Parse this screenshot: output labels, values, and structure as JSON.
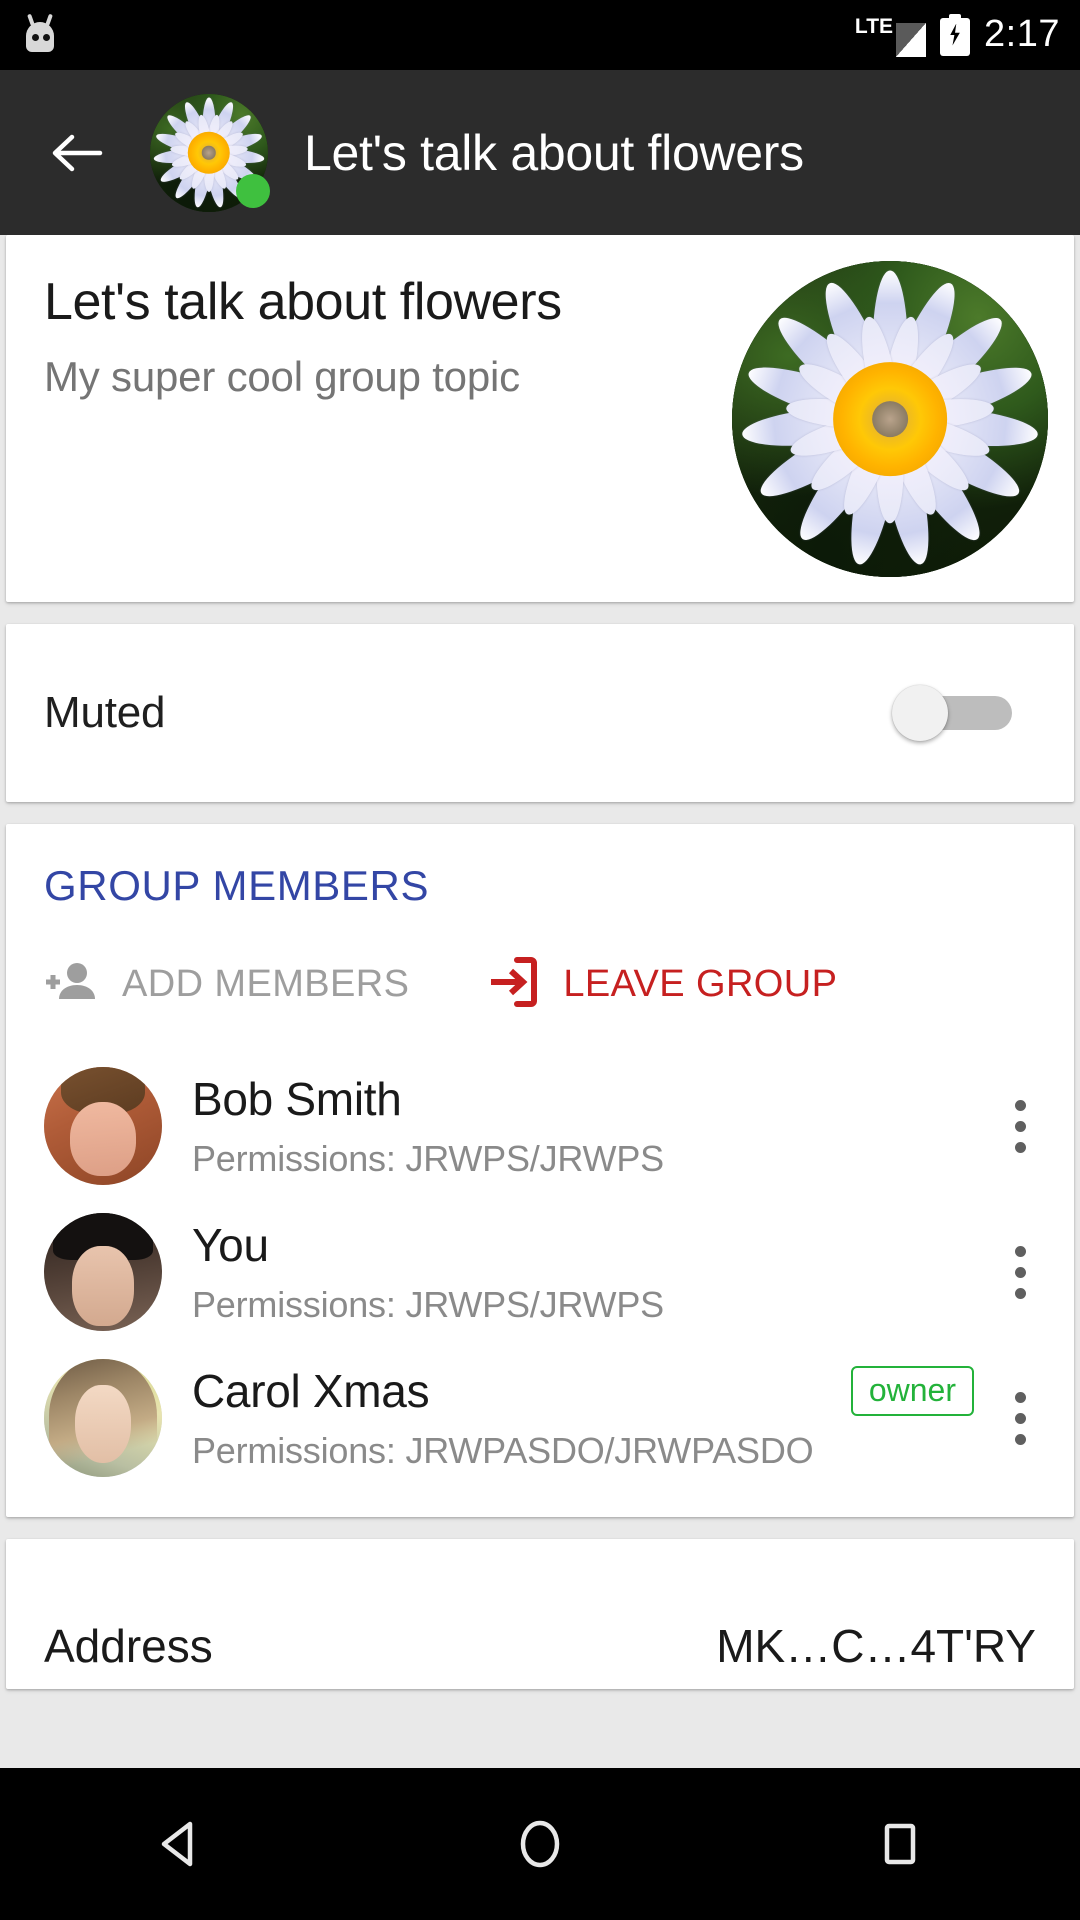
{
  "status_bar": {
    "notification_icon": "cyanogenmod-robot-icon",
    "network_type": "LTE",
    "signal_icon": "signal-bars-icon",
    "battery_icon": "battery-charging-icon",
    "clock": "2:17"
  },
  "toolbar": {
    "back_icon": "back-arrow-icon",
    "avatar_icon": "group-avatar-flower",
    "presence": "online",
    "title": "Let's talk about flowers"
  },
  "header_card": {
    "group_name": "Let's talk about flowers",
    "group_topic": "My super cool group topic",
    "avatar_icon": "group-avatar-flower-large"
  },
  "muted_row": {
    "label": "Muted",
    "enabled": false
  },
  "members_section": {
    "title": "GROUP MEMBERS",
    "title_color": "#3346a5",
    "add_members": {
      "label": "ADD MEMBERS",
      "icon": "person-add-icon",
      "color": "#9e9e9e"
    },
    "leave_group": {
      "label": "LEAVE GROUP",
      "icon": "exit-to-app-icon",
      "color": "#c62020"
    },
    "members": [
      {
        "name": "Bob Smith",
        "permissions": "Permissions: JRWPS/JRWPS",
        "badge": null,
        "avatar_icon": "avatar-bob",
        "overflow_icon": "more-vertical-icon"
      },
      {
        "name": "You",
        "permissions": "Permissions: JRWPS/JRWPS",
        "badge": null,
        "avatar_icon": "avatar-you",
        "overflow_icon": "more-vertical-icon"
      },
      {
        "name": "Carol Xmas",
        "permissions": "Permissions: JRWPASDO/JRWPASDO",
        "badge": "owner",
        "badge_color": "#23b23a",
        "avatar_icon": "avatar-carol",
        "overflow_icon": "more-vertical-icon"
      }
    ]
  },
  "address_row": {
    "label": "Address",
    "value": "MK…C…4T'RY"
  },
  "nav_bar": {
    "back": "nav-back-icon",
    "home": "nav-home-icon",
    "recents": "nav-recents-icon"
  }
}
